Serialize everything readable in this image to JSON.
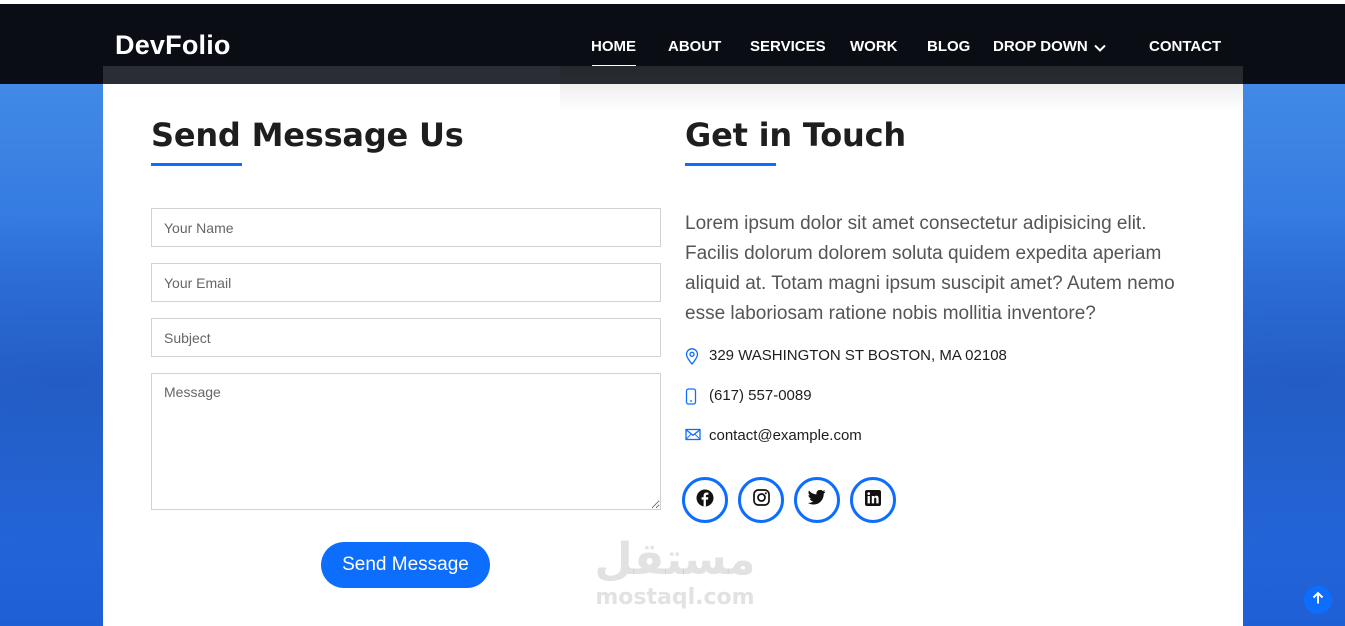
{
  "brand": {
    "logo": "DevFolio"
  },
  "nav": {
    "items": [
      {
        "label": "HOME",
        "active": true
      },
      {
        "label": "ABOUT"
      },
      {
        "label": "SERVICES"
      },
      {
        "label": "WORK"
      },
      {
        "label": "BLOG"
      },
      {
        "label": "DROP DOWN",
        "dropdown": true
      },
      {
        "label": "CONTACT"
      }
    ]
  },
  "form": {
    "title": "Send Message Us",
    "name_placeholder": "Your Name",
    "email_placeholder": "Your Email",
    "subject_placeholder": "Subject",
    "message_placeholder": "Message",
    "submit_label": "Send Message"
  },
  "contact": {
    "title": "Get in Touch",
    "description": "Lorem ipsum dolor sit amet consectetur adipisicing elit. Facilis dolorum dolorem soluta quidem expedita aperiam aliquid at. Totam magni ipsum suscipit amet? Autem nemo esse laboriosam ratione nobis mollitia inventore?",
    "address": "329 WASHINGTON ST BOSTON, MA 02108",
    "phone": "(617) 557-0089",
    "email": "contact@example.com",
    "socials": [
      "facebook-icon",
      "instagram-icon",
      "twitter-icon",
      "linkedin-icon"
    ]
  },
  "watermark": {
    "arabic": "مستقل",
    "latin": "mostaql.com"
  },
  "colors": {
    "accent": "#0d6efd",
    "navbar": "#0a0e14",
    "background": "#2f74df"
  }
}
